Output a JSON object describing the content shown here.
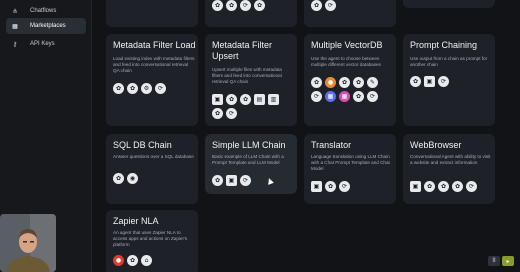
{
  "sidebar": {
    "items": [
      {
        "label": "Chatflows",
        "icon": "hierarchy-icon",
        "glyph": "⋔",
        "active": false
      },
      {
        "label": "Marketplaces",
        "icon": "marketplace-icon",
        "glyph": "▦",
        "active": true
      },
      {
        "label": "API Keys",
        "icon": "key-icon",
        "glyph": "⚷",
        "active": false
      }
    ]
  },
  "cards": [
    {
      "title": "Metadata Filter Load",
      "description": "Load existing index with metadata filters and feed into conversational retrieval QA chain"
    },
    {
      "title": "Metadata Filter Upsert",
      "description": "Upsert multiple files with metadata filters and feed into conversational retrieval QA chain"
    },
    {
      "title": "Multiple VectorDB",
      "description": "Use the agent to choose between multiple different vector databases"
    },
    {
      "title": "Prompt Chaining",
      "description": "Use output from a chain as prompt for another chain"
    },
    {
      "title": "SQL DB Chain",
      "description": "Answer questions over a SQL database"
    },
    {
      "title": "Simple LLM Chain",
      "description": "Basic example of LLM Chain with a Prompt Template and LLM Model"
    },
    {
      "title": "Translator",
      "description": "Language translation using LLM Chain with a Chat Prompt Template and Chat Model"
    },
    {
      "title": "WebBrowser",
      "description": "Conversational Agent with ability to visit a website and extract information"
    },
    {
      "title": "Zapier NLA",
      "description": "An agent that uses Zapier NLA to access apps and actions on Zapier's platform"
    }
  ],
  "pager": {
    "pause_label": "II",
    "next_label": "▸"
  },
  "icons": {
    "node_icon": "integration-icon"
  }
}
